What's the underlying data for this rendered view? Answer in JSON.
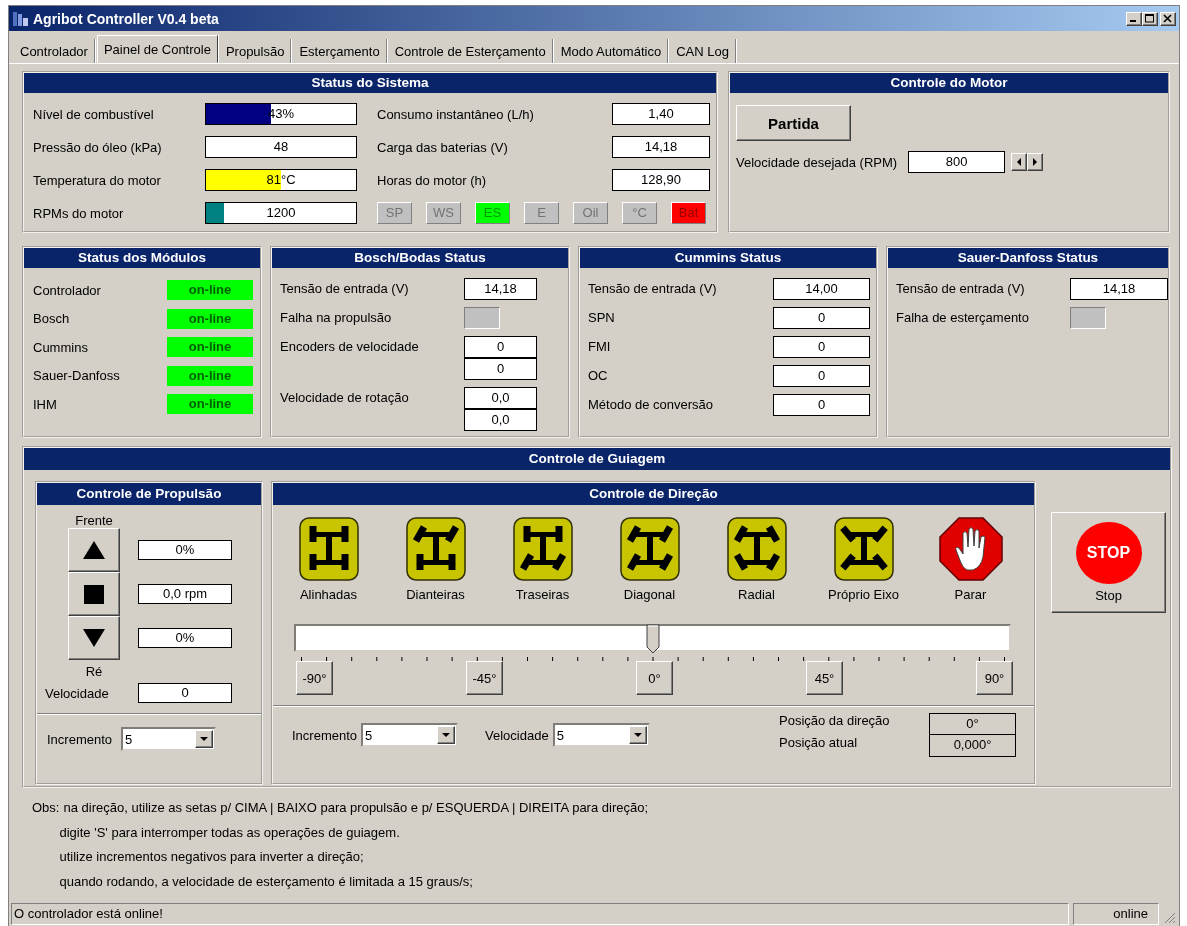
{
  "window": {
    "title": "Agribot Controller V0.4 beta"
  },
  "tabs": [
    {
      "label": "Controlador",
      "selected": false
    },
    {
      "label": "Painel de Controle",
      "selected": true
    },
    {
      "label": "Propulsão",
      "selected": false
    },
    {
      "label": "Esterçamento",
      "selected": false
    },
    {
      "label": "Controle de Esterçamento",
      "selected": false
    },
    {
      "label": "Modo Automático",
      "selected": false
    },
    {
      "label": "CAN Log",
      "selected": false
    }
  ],
  "system_status": {
    "title": "Status do Sistema",
    "rows": [
      {
        "kind": "gauge",
        "label": "Nível de combustível",
        "value": "43%",
        "level": 0.43,
        "color": "#000080"
      },
      {
        "kind": "field",
        "label": "Pressão do óleo (kPa)",
        "value": "48"
      },
      {
        "kind": "gauge",
        "label": "Temperatura do motor",
        "value": "81°C",
        "level": 0.5,
        "color": "#ffff00"
      },
      {
        "kind": "gauge",
        "label": "RPMs do motor",
        "value": "1200",
        "level": 0.12,
        "color": "#008080"
      }
    ],
    "readings": [
      {
        "label": "Consumo instantâneo (L/h)",
        "value": "1,40"
      },
      {
        "label": "Carga das baterias (V)",
        "value": "14,18"
      },
      {
        "label": "Horas do motor (h)",
        "value": "128,90"
      }
    ],
    "indicators": [
      {
        "label": "SP",
        "color": "#c0c0c0"
      },
      {
        "label": "WS",
        "color": "#c0c0c0"
      },
      {
        "label": "ES",
        "color": "#00ff00"
      },
      {
        "label": "E",
        "color": "#c0c0c0"
      },
      {
        "label": "Oil",
        "color": "#c0c0c0"
      },
      {
        "label": "°C",
        "color": "#c0c0c0"
      },
      {
        "label": "Bat",
        "color": "#ff0000"
      }
    ]
  },
  "motor_control": {
    "title": "Controle do Motor",
    "start_button": "Partida",
    "speed_label": "Velocidade desejada (RPM)",
    "speed_value": "800"
  },
  "modules": {
    "title": "Status dos Módulos",
    "items": [
      {
        "name": "Controlador",
        "status": "on-line",
        "online": true
      },
      {
        "name": "Bosch",
        "status": "on-line",
        "online": true
      },
      {
        "name": "Cummins",
        "status": "on-line",
        "online": true
      },
      {
        "name": "Sauer-Danfoss",
        "status": "on-line",
        "online": true
      },
      {
        "name": "IHM",
        "status": "on-line",
        "online": true
      }
    ]
  },
  "bosch": {
    "title": "Bosch/Bodas Status",
    "rows": [
      {
        "kind": "fields",
        "label": "Tensão de entrada (V)",
        "values": [
          "14,18"
        ]
      },
      {
        "kind": "fault",
        "label": "Falha na propulsão",
        "active": false
      },
      {
        "kind": "fields",
        "label": "Encoders de velocidade",
        "values": [
          "0",
          "0"
        ]
      },
      {
        "kind": "fields",
        "label": "Velocidade de rotação",
        "values": [
          "0,0",
          "0,0"
        ]
      }
    ]
  },
  "cummins": {
    "title": "Cummins Status",
    "rows": [
      {
        "kind": "fields",
        "label": "Tensão de entrada (V)",
        "values": [
          "14,00"
        ]
      },
      {
        "kind": "fields",
        "label": "SPN",
        "values": [
          "0"
        ]
      },
      {
        "kind": "fields",
        "label": "FMI",
        "values": [
          "0"
        ]
      },
      {
        "kind": "fields",
        "label": "OC",
        "values": [
          "0"
        ]
      },
      {
        "kind": "fields",
        "label": "Método de conversão",
        "values": [
          "0"
        ]
      }
    ]
  },
  "sauer_danfoss": {
    "title": "Sauer-Danfoss Status",
    "rows": [
      {
        "kind": "fields",
        "label": "Tensão de entrada (V)",
        "values": [
          "14,18"
        ]
      },
      {
        "kind": "fault",
        "label": "Falha de esterçamento",
        "active": false
      }
    ]
  },
  "guidance": {
    "title": "Controle de Guiagem",
    "propulsion": {
      "title": "Controle de Propulsão",
      "forward_label": "Frente",
      "reverse_label": "Ré",
      "readouts": [
        "0%",
        "0,0 rpm",
        "0%"
      ],
      "speed_label": "Velocidade",
      "speed_value": "0",
      "increment_label": "Incremento",
      "increment_value": "5"
    },
    "direction": {
      "title": "Controle de Direção",
      "modes": [
        {
          "kind": "aligned",
          "label": "Alinhadas"
        },
        {
          "kind": "front",
          "label": "Dianteiras"
        },
        {
          "kind": "rear",
          "label": "Traseiras"
        },
        {
          "kind": "diagonal",
          "label": "Diagonal"
        },
        {
          "kind": "radial",
          "label": "Radial"
        },
        {
          "kind": "pivot",
          "label": "Próprio Eixo"
        },
        {
          "kind": "stop",
          "label": "Parar"
        }
      ],
      "steering": {
        "level": 0.5
      },
      "angle_buttons": [
        "-90°",
        "-45°",
        "0°",
        "45°",
        "90°"
      ],
      "increment_label": "Incremento",
      "increment_value": "5",
      "speed_label": "Velocidade",
      "speed_value": "5",
      "positions": [
        {
          "label": "Posição da direção",
          "value": "0°"
        },
        {
          "label": "Posição atual",
          "value": "0,000°"
        }
      ]
    },
    "stop_button": {
      "sign": "STOP",
      "label": "Stop"
    }
  },
  "notes": {
    "prefix": "Obs:",
    "lines": [
      "na direção, utilize as setas p/ CIMA | BAIXO para propulsão e p/ ESQUERDA | DIREITA para direção;",
      "digite 'S' para interromper todas as operações de guiagem.",
      "utilize incrementos negativos para inverter a direção;",
      "quando rodando, a velocidade de esterçamento é limitada a 15 graus/s;"
    ]
  },
  "status_bar": {
    "message": "O controlador está online!",
    "status": "online"
  }
}
